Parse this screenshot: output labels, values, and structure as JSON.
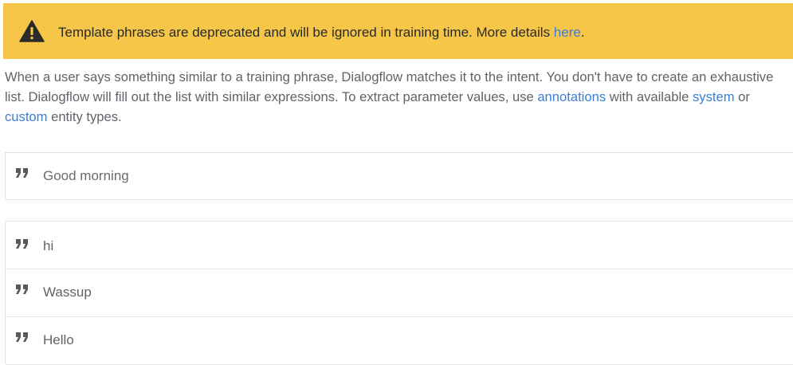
{
  "banner": {
    "message": "Template phrases are deprecated and will be ignored in training time. More details ",
    "link_text": "here",
    "end_punct": ".",
    "icon": "warning-icon"
  },
  "description": {
    "part1": "When a user says something similar to a training phrase, Dialogflow matches it to the intent. You don't have to create an exhaustive list. Dialogflow will fill out the list with similar expressions. To extract parameter values, use ",
    "link_annotations": "annotations",
    "part2": " with available ",
    "link_system": "system",
    "part3": " or ",
    "link_custom": "custom",
    "part4": " entity types."
  },
  "new_phrase": {
    "placeholder": "Good morning",
    "icon": "quote-icon"
  },
  "training_phrases": [
    {
      "text": "hi",
      "icon": "quote-icon"
    },
    {
      "text": "Wassup",
      "icon": "quote-icon"
    },
    {
      "text": "Hello",
      "icon": "quote-icon"
    }
  ],
  "colors": {
    "banner_bg": "#f6c649",
    "link": "#3a7fd5",
    "text": "#5f6368"
  }
}
